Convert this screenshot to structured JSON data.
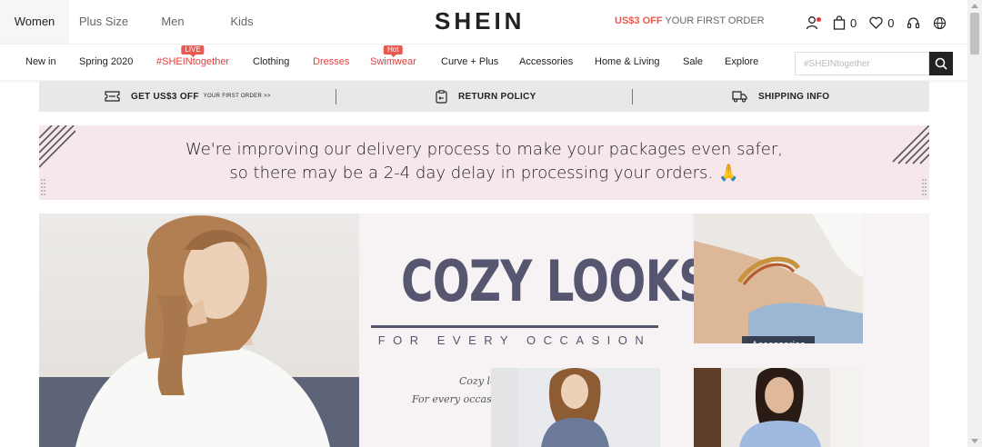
{
  "header": {
    "category_tabs": [
      {
        "label": "Women",
        "active": true
      },
      {
        "label": "Plus Size",
        "active": false
      },
      {
        "label": "Men",
        "active": false
      },
      {
        "label": "Kids",
        "active": false
      }
    ],
    "logo": "SHEIN",
    "promo": {
      "highlight": "US$3 OFF",
      "text": " YOUR FIRST ORDER"
    },
    "cart_count": "0",
    "wishlist_count": "0",
    "icons": [
      "account-icon",
      "bag-icon",
      "heart-icon",
      "headset-icon",
      "globe-icon"
    ]
  },
  "nav": {
    "items": [
      {
        "label": "New in",
        "red": false,
        "tag": ""
      },
      {
        "label": "Spring 2020",
        "red": false,
        "tag": ""
      },
      {
        "label": "#SHEINtogether",
        "red": true,
        "tag": "LIVE"
      },
      {
        "label": "Clothing",
        "red": false,
        "tag": ""
      },
      {
        "label": "Dresses",
        "red": true,
        "tag": ""
      },
      {
        "label": "Swimwear",
        "red": true,
        "tag": "Hot"
      },
      {
        "label": "Curve + Plus",
        "red": false,
        "tag": ""
      },
      {
        "label": "Accessories",
        "red": false,
        "tag": ""
      },
      {
        "label": "Home & Living",
        "red": false,
        "tag": ""
      },
      {
        "label": "Sale",
        "red": false,
        "tag": ""
      },
      {
        "label": "Explore",
        "red": false,
        "tag": ""
      }
    ],
    "search_placeholder": "#SHEINtogether"
  },
  "info_strip": {
    "offer": {
      "label": "GET US$3 OFF",
      "small": "YOUR FIRST ORDER >>"
    },
    "return": "RETURN POLICY",
    "shipping": "SHIPPING INFO"
  },
  "notice": {
    "line1": "We're improving our delivery process to make your packages even safer,",
    "line2": "so there may be a 2-4 day delay in processing your orders.",
    "emoji": "🙏"
  },
  "hero": {
    "title": "COZY LOOKS",
    "subtitle": "FOR EVERY OCCASION",
    "script_line1": "Cozy looks",
    "script_line2": "For every occasion",
    "tile_label": "Accessories"
  },
  "colors": {
    "accent_red": "#e23b3b",
    "promo_red": "#e65a4f",
    "hero_text": "#565670",
    "notice_bg": "#f5e7ea"
  }
}
